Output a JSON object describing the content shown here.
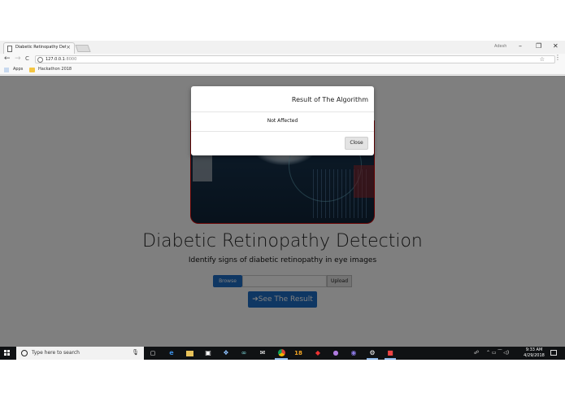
{
  "browser": {
    "tab_title": "Diabetic Retinopathy Det",
    "tab_close": "×",
    "user_name": "Adesh",
    "window_controls": {
      "minimize": "–",
      "restore": "❐",
      "close": "✕"
    },
    "nav": {
      "back": "←",
      "forward": "→",
      "reload": "C"
    },
    "url_host": "127.0.0.1",
    "url_port": ":8000",
    "star": "☆",
    "menu": "⋮",
    "bookmarks": {
      "apps": "Apps",
      "folder": "Hackathon 2018"
    }
  },
  "page": {
    "title": "Diabetic Retinopathy Detection",
    "subtitle": "Identify signs of diabetic retinopathy in eye images",
    "browse_label": "Browse",
    "upload_label": "Upload",
    "result_label": "➔See The Result"
  },
  "modal": {
    "title": "Result of The Algorithm",
    "result": "Not Affected",
    "close_label": "Close"
  },
  "taskbar": {
    "search_placeholder": "Type here to search",
    "mic": "🎙",
    "task_view": "▢",
    "icons": [
      "edge-icon",
      "file-explorer-icon",
      "store-icon",
      "dropbox-icon",
      "infinity-icon",
      "mail-icon",
      "chrome-icon",
      "badge-18-icon",
      "app-red-icon",
      "github-icon",
      "app-purple-icon",
      "settings-icon",
      "app-red2-icon"
    ],
    "app_badge": "18",
    "tray_text": "⌃  ▭  ⁀  ◁)",
    "people_icon": "☍",
    "time": "9:33 AM",
    "date": "4/29/2018"
  },
  "colors": {
    "primary_button": "#1f6fc6",
    "backdrop": "rgba(0,0,0,0.5)",
    "taskbar": "#101214"
  }
}
